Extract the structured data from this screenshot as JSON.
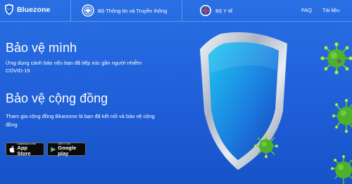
{
  "header": {
    "brand": "Bluezone",
    "org1": "Bộ Thông tin và Truyền thông",
    "org2": "Bộ Y tế",
    "nav": [
      "FAQ",
      "Tài liệu"
    ]
  },
  "hero": {
    "title1": "Bảo vệ mình",
    "desc1": "Ứng dụng cảnh báo nếu bạn đã tiếp xúc gần người nhiễm COVID-19",
    "title2": "Bảo vệ cộng đồng",
    "desc2": "Tham gia cộng đồng Bluezone là bạn đã kết nối và bảo vệ cộng đồng"
  },
  "stores": {
    "appstore": {
      "small": "Download on the",
      "big": "App Store",
      "icon": "apple-icon"
    },
    "googleplay": {
      "small": "GET IT ON",
      "big": "Google play",
      "icon": "google-play-icon"
    }
  },
  "colors": {
    "background": "#1f5fd8",
    "accent": "#1ec8f0",
    "virus": "#5bc236"
  }
}
